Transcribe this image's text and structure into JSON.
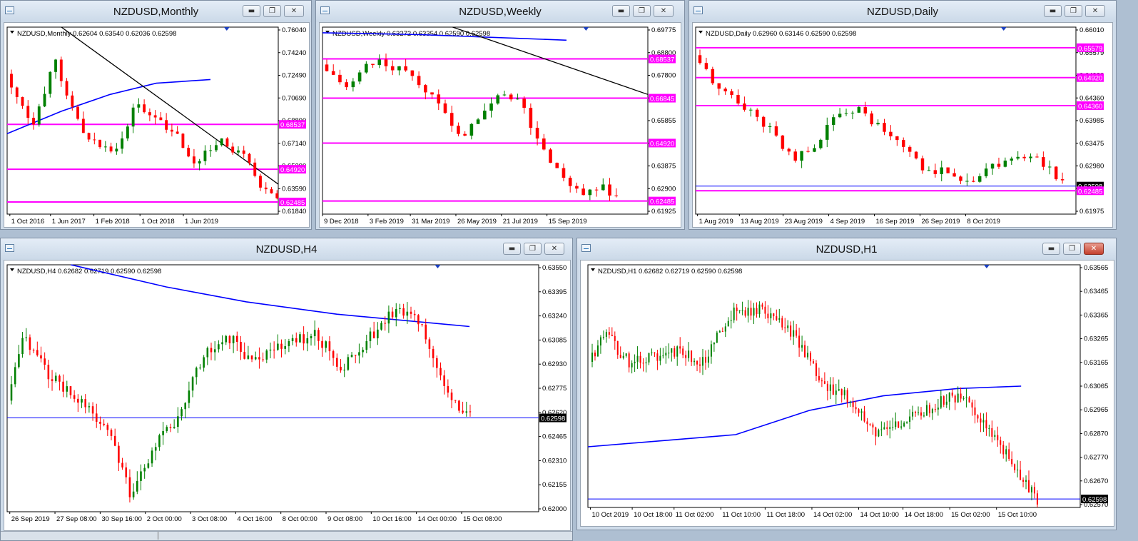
{
  "colors": {
    "bull": "#008000",
    "bear": "#ff0000",
    "level": "#ff00ff",
    "ma": "#0000ff",
    "trend": "#000000",
    "price_tag": "#000000"
  },
  "icons": {
    "app": "chart-window-icon",
    "minimize": "minimize-icon",
    "restore": "restore-icon",
    "close": "close-icon",
    "dropdown": "dropdown-triangle-icon",
    "shift": "chart-shift-marker-icon"
  },
  "windows": [
    {
      "id": "monthly",
      "title": "NZDUSD,Monthly",
      "header": "NZDUSD,Monthly  0.62604 0.63540 0.62036 0.62598",
      "active": false,
      "y_ticks": [
        "0.76040",
        "0.74240",
        "0.72490",
        "0.70690",
        "0.68890",
        "0.67140",
        "0.65390",
        "0.63590",
        "0.61840"
      ],
      "x_ticks": [
        "1 Oct 2016",
        "1 Jun 2017",
        "1 Feb 2018",
        "1 Oct 2018",
        "1 Jun 2019"
      ],
      "tags": [
        {
          "value": "0.68537",
          "kind": "level"
        },
        {
          "value": "0.64920",
          "kind": "level"
        },
        {
          "value": "0.62485",
          "kind": "level"
        }
      ]
    },
    {
      "id": "weekly",
      "title": "NZDUSD,Weekly",
      "header": "NZDUSD,Weekly  0.63272 0.63354 0.62590 0.62598",
      "active": false,
      "y_ticks": [
        "0.69775",
        "0.68800",
        "0.67800",
        "0.66845",
        "0.65855",
        "0.64920",
        "0.63875",
        "0.62900",
        "0.61925"
      ],
      "x_ticks": [
        "9 Dec 2018",
        "3 Feb 2019",
        "31 Mar 2019",
        "26 May 2019",
        "21 Jul 2019",
        "15 Sep 2019"
      ],
      "tags": [
        {
          "value": "0.68537",
          "kind": "level"
        },
        {
          "value": "0.66845",
          "kind": "level"
        },
        {
          "value": "0.64920",
          "kind": "level"
        },
        {
          "value": "0.62485",
          "kind": "level"
        }
      ]
    },
    {
      "id": "daily",
      "title": "NZDUSD,Daily",
      "header": "NZDUSD,Daily  0.62960 0.63146 0.62590 0.62598",
      "active": false,
      "y_ticks": [
        "0.66010",
        "0.65579",
        "0.64920",
        "0.64360",
        "0.63985",
        "0.63475",
        "0.62980",
        "0.62485",
        "0.61975"
      ],
      "x_ticks": [
        "1 Aug 2019",
        "13 Aug 2019",
        "23 Aug 2019",
        "4 Sep 2019",
        "16 Sep 2019",
        "26 Sep 2019",
        "8 Oct 2019"
      ],
      "tags": [
        {
          "value": "0.65579",
          "kind": "level"
        },
        {
          "value": "0.64920",
          "kind": "level"
        },
        {
          "value": "0.64360",
          "kind": "level"
        },
        {
          "value": "0.62598",
          "kind": "price"
        },
        {
          "value": "0.62485",
          "kind": "level"
        }
      ]
    },
    {
      "id": "h4",
      "title": "NZDUSD,H4",
      "header": "NZDUSD,H4  0.62682 0.62719 0.62590 0.62598",
      "active": false,
      "y_ticks": [
        "0.63550",
        "0.63395",
        "0.63240",
        "0.63085",
        "0.62930",
        "0.62775",
        "0.62620",
        "0.62465",
        "0.62310",
        "0.62155",
        "0.62000"
      ],
      "x_ticks": [
        "26 Sep 2019",
        "27 Sep 08:00",
        "30 Sep 16:00",
        "2 Oct 00:00",
        "3 Oct 08:00",
        "4 Oct 16:00",
        "8 Oct 00:00",
        "9 Oct 08:00",
        "10 Oct 16:00",
        "14 Oct 00:00",
        "15 Oct 08:00"
      ],
      "tags": [
        {
          "value": "0.62598",
          "kind": "price"
        }
      ]
    },
    {
      "id": "h1",
      "title": "NZDUSD,H1",
      "header": "NZDUSD,H1  0.62682 0.62719 0.62590 0.62598",
      "active": true,
      "y_ticks": [
        "0.63565",
        "0.63465",
        "0.63365",
        "0.63265",
        "0.63165",
        "0.63065",
        "0.62965",
        "0.62870",
        "0.62770",
        "0.62670",
        "0.62570"
      ],
      "x_ticks": [
        "10 Oct 2019",
        "10 Oct 18:00",
        "11 Oct 02:00",
        "11 Oct 10:00",
        "11 Oct 18:00",
        "14 Oct 02:00",
        "14 Oct 10:00",
        "14 Oct 18:00",
        "15 Oct 02:00",
        "15 Oct 10:00"
      ],
      "tags": [
        {
          "value": "0.62598",
          "kind": "price"
        }
      ]
    }
  ]
}
